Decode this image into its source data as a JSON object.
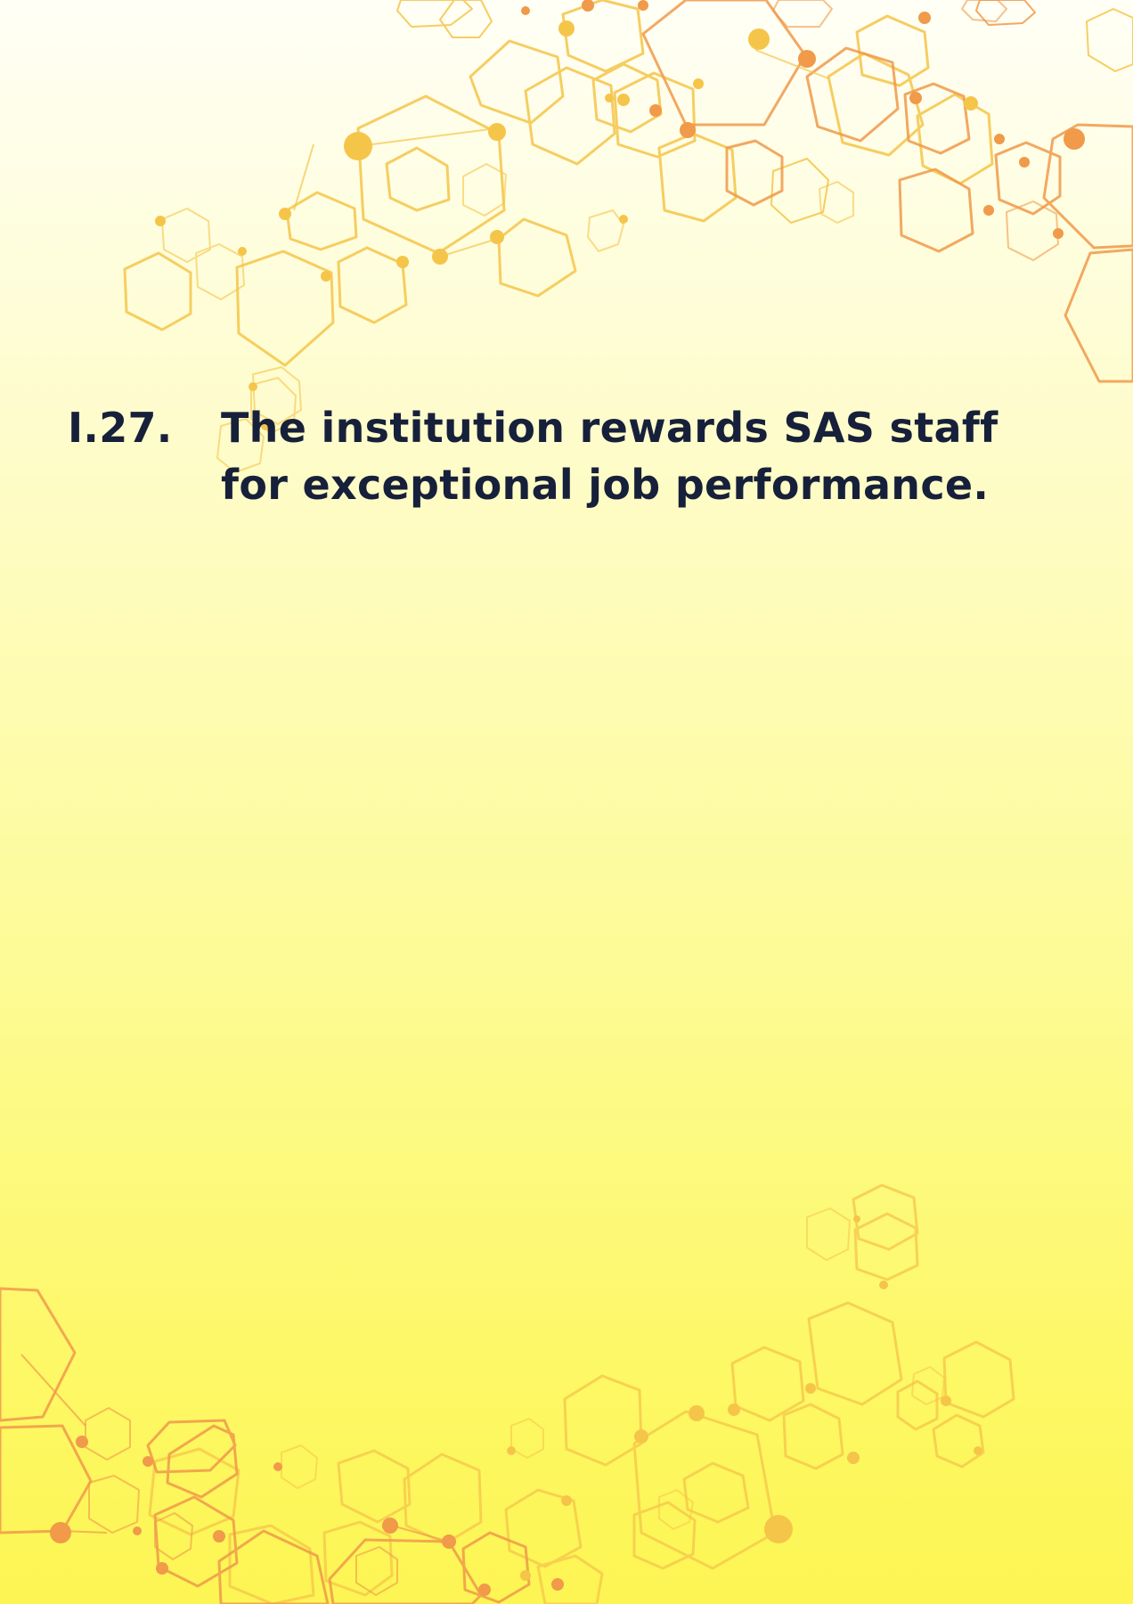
{
  "item": {
    "number": "I.27.",
    "text": "The institution rewards SAS staff for exceptional job performance."
  },
  "colors": {
    "background_top": "#fffff6",
    "background_bottom": "#fdf553",
    "hexagon_yellow": "#f5c54a",
    "hexagon_orange": "#f09a4a",
    "text": "#17203a"
  },
  "decorations": {
    "top_cluster": "hexagon-network",
    "bottom_cluster": "hexagon-network"
  }
}
